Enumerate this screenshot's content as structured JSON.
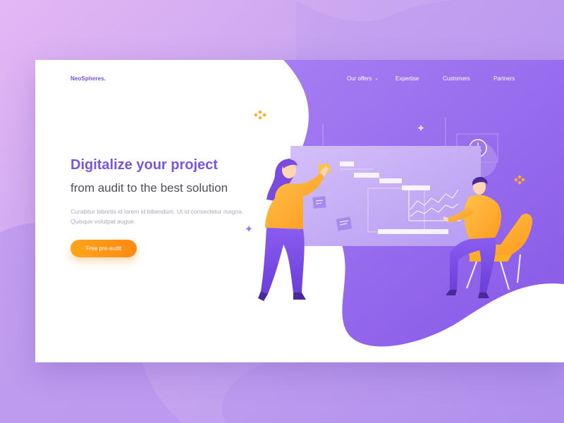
{
  "brand": {
    "name": "NeoSpheres."
  },
  "nav": {
    "items": [
      {
        "label": "Our offers",
        "has_dropdown": true
      },
      {
        "label": "Expertise"
      },
      {
        "label": "Customers"
      },
      {
        "label": "Partners"
      }
    ]
  },
  "hero": {
    "headline": "Digitalize your project",
    "subheadline": "from audit to the best solution",
    "body": "Curabitur lobortis id lorem id bibendum. Ut id consectetur magna. Quisque volutpat augue.",
    "cta_label": "Free pre-audit"
  },
  "icons": {
    "dropdown": "chevron-down-icon",
    "clock": "clock-icon",
    "sparkle": "sparkle-icon"
  },
  "colors": {
    "brand": "#7650d8",
    "headline": "#7b55d8",
    "accent_purple": "#9b6ef0",
    "cta": "#ff9916",
    "body_text": "#a9a9bd"
  }
}
